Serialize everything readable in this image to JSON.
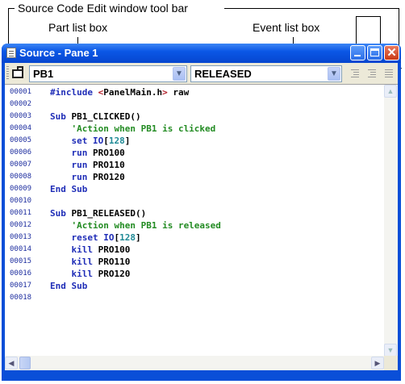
{
  "callouts": {
    "toolbar": "Source Code Edit window tool bar",
    "part_list": "Part list box",
    "event_list": "Event list box"
  },
  "window": {
    "title": "Source - Pane 1",
    "controls": {
      "minimize": "minimize-icon",
      "maximize": "maximize-icon",
      "close": "close-icon"
    }
  },
  "toolbar": {
    "part_value": "PB1",
    "event_value": "RELEASED",
    "buttons": [
      "pane-icon",
      "indent-icon",
      "outdent-icon",
      "align-icon"
    ]
  },
  "colors": {
    "titlebar": "#0b57e6",
    "keyword": "#1f2db7",
    "comment": "#228b22",
    "preprocessor": "#b3202a",
    "number": "#208a96",
    "line_number": "#2030a0"
  },
  "editor": {
    "line_numbers": [
      "00001",
      "00002",
      "00003",
      "00004",
      "00005",
      "00006",
      "00007",
      "00008",
      "00009",
      "00010",
      "00011",
      "00012",
      "00013",
      "00014",
      "00015",
      "00016",
      "00017",
      "00018"
    ],
    "lines": [
      "#include <PanelMain.h> raw",
      "",
      "Sub PB1_CLICKED()",
      "    'Action when PB1 is clicked",
      "    set IO[128]",
      "    run PRO100",
      "    run PRO110",
      "    run PRO120",
      "End Sub",
      "",
      "Sub PB1_RELEASED()",
      "    'Action when PB1 is released",
      "    reset IO[128]",
      "    kill PRO100",
      "    kill PRO110",
      "    kill PRO120",
      "End Sub",
      ""
    ]
  }
}
